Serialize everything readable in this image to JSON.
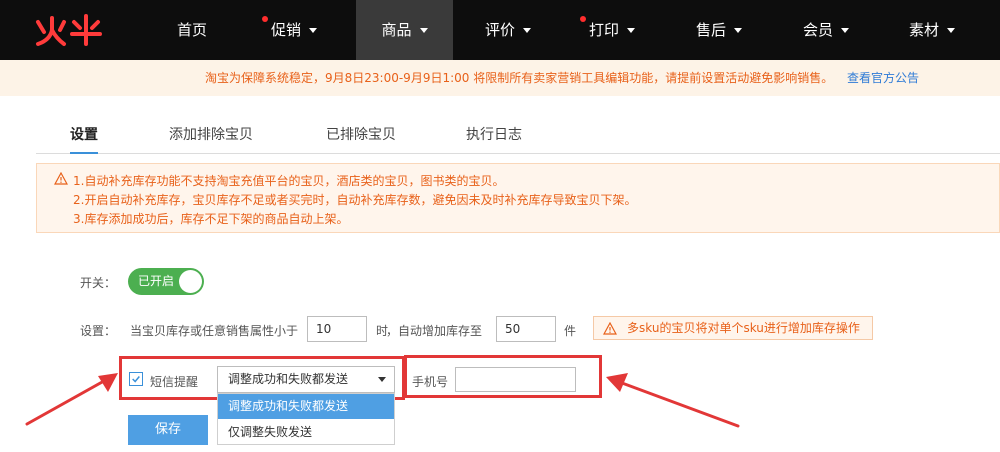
{
  "nav": {
    "logo_text": "火牛",
    "items": [
      {
        "label": "首页",
        "dot": false,
        "caret": false,
        "active": false
      },
      {
        "label": "促销",
        "dot": true,
        "caret": true,
        "active": false
      },
      {
        "label": "商品",
        "dot": false,
        "caret": true,
        "active": true
      },
      {
        "label": "评价",
        "dot": false,
        "caret": true,
        "active": false
      },
      {
        "label": "打印",
        "dot": true,
        "caret": true,
        "active": false
      },
      {
        "label": "售后",
        "dot": false,
        "caret": true,
        "active": false
      },
      {
        "label": "会员",
        "dot": false,
        "caret": true,
        "active": false
      },
      {
        "label": "素材",
        "dot": false,
        "caret": true,
        "active": false
      }
    ]
  },
  "notice": {
    "text": "淘宝为保障系统稳定，9月8日23:00-9月9日1:00 将限制所有卖家营销工具编辑功能，请提前设置活动避免影响销售。",
    "link": "查看官方公告"
  },
  "tabs": [
    {
      "label": "设置",
      "active": true
    },
    {
      "label": "添加排除宝贝",
      "active": false
    },
    {
      "label": "已排除宝贝",
      "active": false
    },
    {
      "label": "执行日志",
      "active": false
    }
  ],
  "warnings": [
    "1.自动补充库存功能不支持淘宝充值平台的宝贝，酒店类的宝贝，图书类的宝贝。",
    "2.开启自动补充库存，宝贝库存不足或者买完时，自动补充库存数，避免因未及时补充库存导致宝贝下架。",
    "3.库存添加成功后，库存不足下架的商品自动上架。"
  ],
  "form": {
    "switch_label": "开关：",
    "switch_state": "已开启",
    "settings_label": "设置：",
    "settings_prefix": "当宝贝库存或任意销售属性小于",
    "threshold_value": "10",
    "unit_hour": "时",
    "settings_mid": "，自动增加库存至",
    "target_value": "50",
    "unit_piece": "件",
    "sku_hint": "多sku的宝贝将对单个sku进行增加库存操作",
    "sms_label": "短信提醒",
    "sms_checked": true,
    "select_value": "调整成功和失败都发送",
    "options": [
      "调整成功和失败都发送",
      "仅调整失败发送"
    ],
    "phone_label": "手机号",
    "phone_value": "",
    "save_label": "保存"
  },
  "colors": {
    "nav_bg": "#0d0d0d",
    "accent_blue": "#4f9fe3",
    "warning_orange": "#e8611a",
    "switch_green": "#4caf50",
    "annotation_red": "#e23737"
  }
}
